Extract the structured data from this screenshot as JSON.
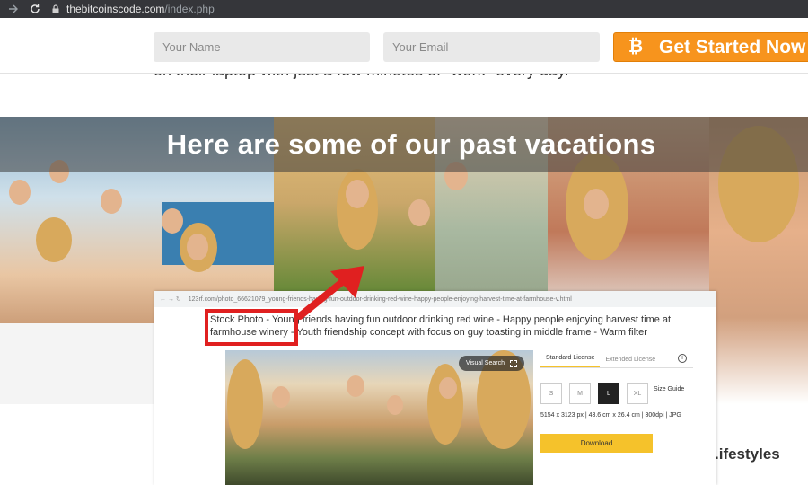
{
  "browser": {
    "url_host": "thebitcoinscode.com",
    "url_path": "/index.php"
  },
  "signup": {
    "name_placeholder": "Your Name",
    "email_placeholder": "Your Email",
    "cta_icon": "bitcoin-icon",
    "cta_label": "Get Started Now",
    "cta_color": "#f7941d"
  },
  "behind_text": "on their laptop with just a few minutes of \"work\" every day.",
  "banner": {
    "title": "Here are some of our past vacations"
  },
  "stock": {
    "url": "123rf.com/photo_66621079_young-friends-having-fun-outdoor-drinking-red-wine-happy-people-enjoying-harvest-time-at-farmhouse-v.html",
    "title": "Stock Photo - Young friends having fun outdoor drinking red wine - Happy people enjoying harvest time at farmhouse winery - Youth friendship concept with focus on guy toasting in middle frame - Warm filter",
    "visual_search": "Visual Search",
    "tabs": [
      "Standard License",
      "Extended License"
    ],
    "sizes": [
      "S",
      "M",
      "L",
      "XL"
    ],
    "active_size": "L",
    "size_guide": "Size Guide",
    "dims": "5154 x 3123 px | 43.6 cm x 26.4 cm | 300dpi | JPG",
    "download": "Download",
    "highlight_color": "#e02020"
  },
  "footer_text": ".ifestyles"
}
